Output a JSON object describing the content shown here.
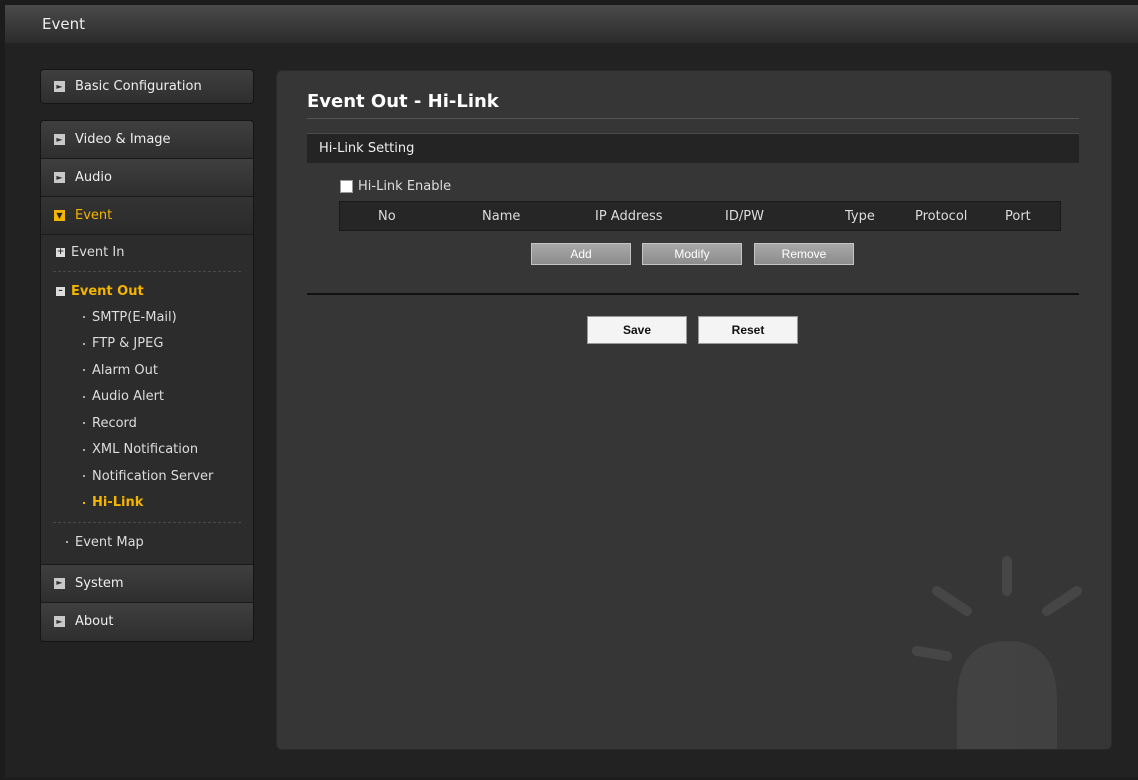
{
  "window": {
    "title": "Event"
  },
  "sidebar": {
    "basic_configuration": "Basic Configuration",
    "video_image": "Video & Image",
    "audio": "Audio",
    "event": "Event",
    "event_in": "Event In",
    "event_out": "Event Out",
    "event_out_items": [
      "SMTP(E-Mail)",
      "FTP & JPEG",
      "Alarm Out",
      "Audio Alert",
      "Record",
      "XML Notification",
      "Notification Server",
      "Hi-Link"
    ],
    "event_map": "Event Map",
    "system": "System",
    "about": "About"
  },
  "main": {
    "page_title": "Event Out - Hi-Link",
    "section_title": "Hi-Link Setting",
    "enable_label": "Hi-Link Enable",
    "enable_checked": false,
    "table_columns": [
      "No",
      "Name",
      "IP Address",
      "ID/PW",
      "Type",
      "Protocol",
      "Port"
    ],
    "buttons": {
      "add": "Add",
      "modify": "Modify",
      "remove": "Remove"
    },
    "save": "Save",
    "reset": "Reset"
  },
  "colors": {
    "accent": "#f4b400",
    "background": "#222222",
    "panel": "#363636"
  }
}
